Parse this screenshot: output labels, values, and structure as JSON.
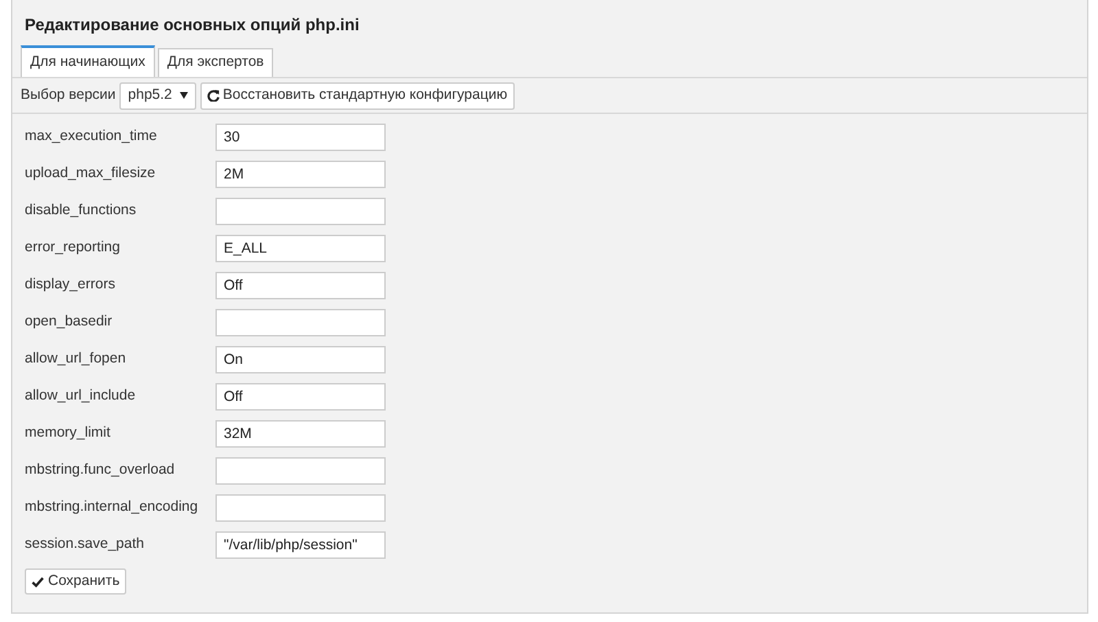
{
  "title": "Редактирование основных опций php.ini",
  "tabs": [
    {
      "label": "Для начинающих",
      "selected": true
    },
    {
      "label": "Для экспертов",
      "selected": false
    }
  ],
  "toolbar": {
    "version_label": "Выбор версии",
    "version": "php5.2",
    "restore_button": "Восстановить стандартную конфигурацию"
  },
  "options": [
    {
      "name": "max_execution_time",
      "value": "30"
    },
    {
      "name": "upload_max_filesize",
      "value": "2M"
    },
    {
      "name": "disable_functions"
    },
    {
      "name": "error_reporting",
      "value": "E_ALL"
    },
    {
      "name": "display_errors",
      "value": "Off"
    },
    {
      "name": "open_basedir"
    },
    {
      "name": "allow_url_fopen",
      "value": "On"
    },
    {
      "name": "allow_url_include",
      "value": "Off"
    },
    {
      "name": "memory_limit",
      "value": "32M"
    },
    {
      "name": "mbstring.func_overload"
    },
    {
      "name": "mbstring.internal_encoding"
    },
    {
      "name": "session.save_path",
      "value": "\"/var/lib/php/session\""
    }
  ],
  "save_button": "Сохранить"
}
